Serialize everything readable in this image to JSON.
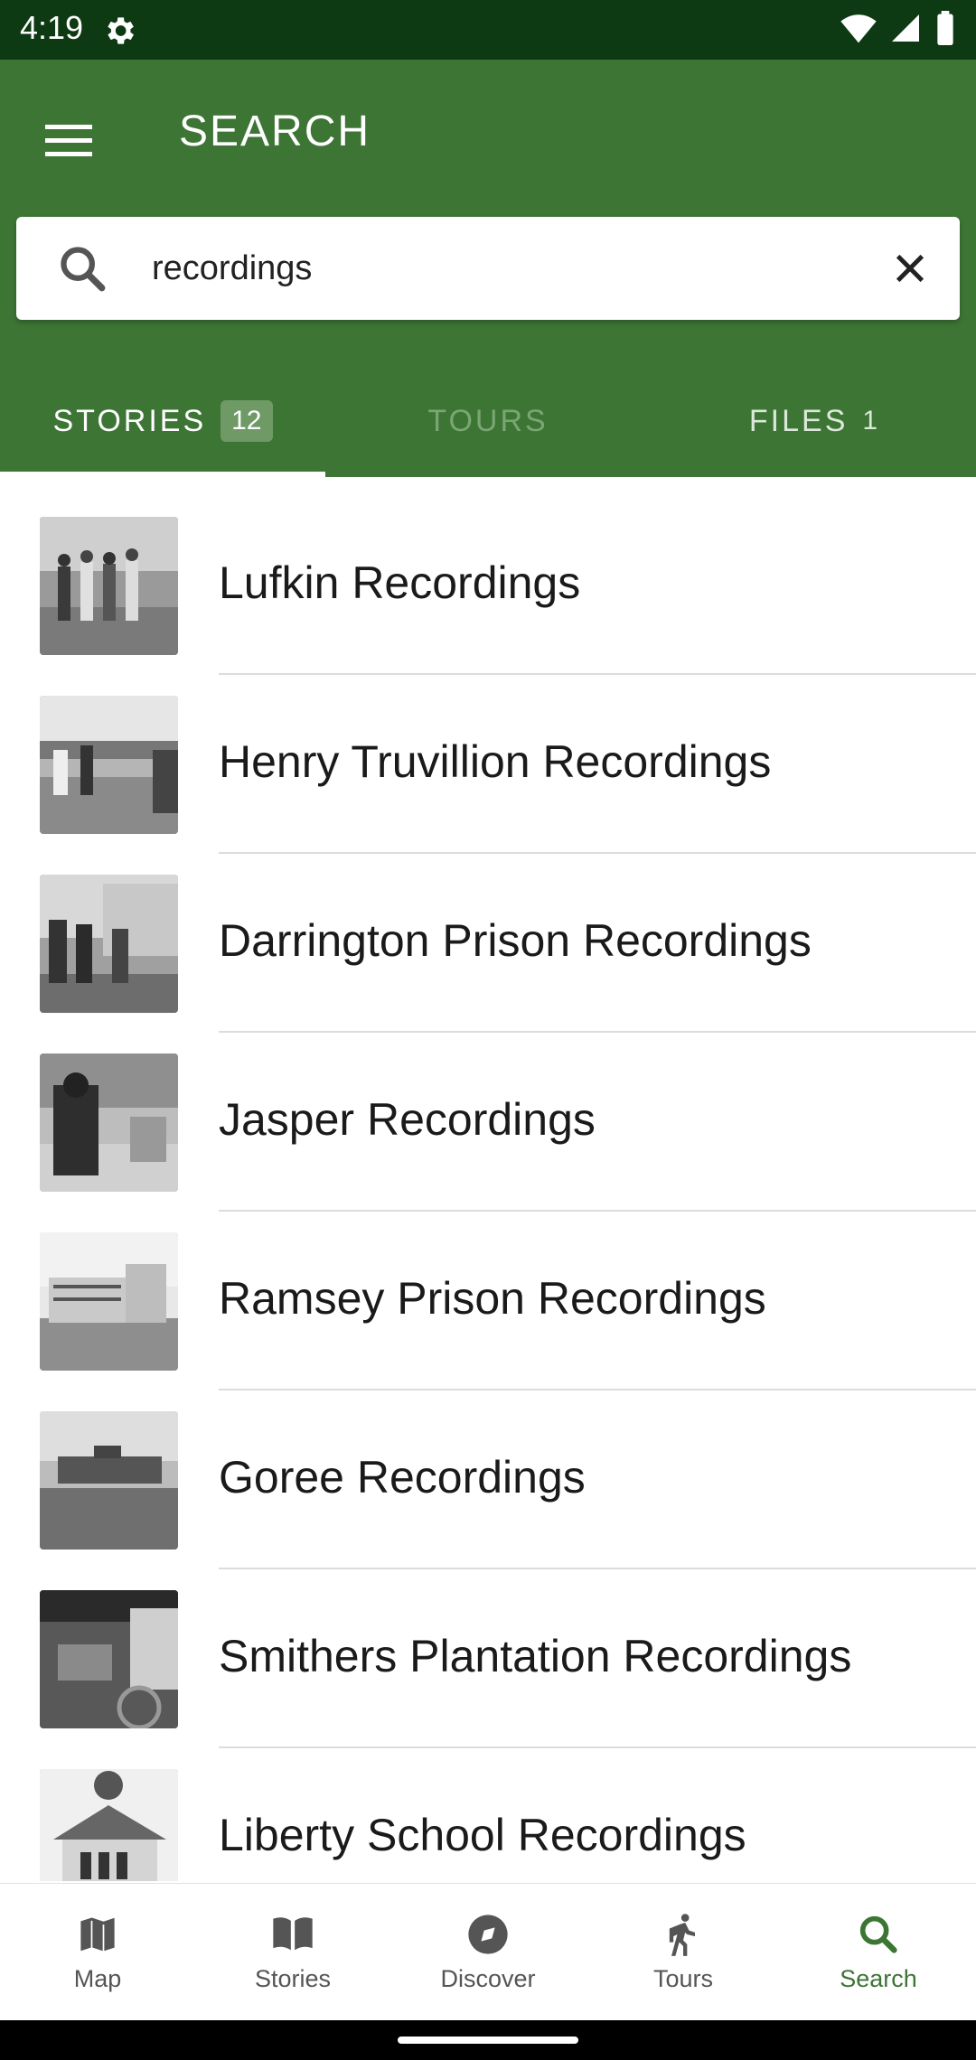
{
  "status_bar": {
    "time": "4:19",
    "icons": [
      "gear-icon",
      "wifi-icon",
      "signal-icon",
      "battery-icon"
    ]
  },
  "app_bar": {
    "title": "SEARCH",
    "menu_icon": "hamburger-menu-icon",
    "color": "#3d7535"
  },
  "search": {
    "value": "recordings",
    "icon": "search-icon",
    "clear_icon": "close-icon"
  },
  "tabs": [
    {
      "label": "STORIES",
      "count": "12",
      "state": "active"
    },
    {
      "label": "TOURS",
      "count": "",
      "state": "disabled"
    },
    {
      "label": "FILES",
      "count": "1",
      "state": "inactive"
    }
  ],
  "results": [
    {
      "title": "Lufkin Recordings"
    },
    {
      "title": "Henry Truvillion Recordings"
    },
    {
      "title": "Darrington Prison Recordings"
    },
    {
      "title": "Jasper Recordings"
    },
    {
      "title": "Ramsey Prison Recordings"
    },
    {
      "title": "Goree Recordings"
    },
    {
      "title": "Smithers Plantation Recordings"
    },
    {
      "title": "Liberty School Recordings"
    }
  ],
  "bottom_nav": [
    {
      "label": "Map",
      "icon": "map-icon"
    },
    {
      "label": "Stories",
      "icon": "book-icon"
    },
    {
      "label": "Discover",
      "icon": "compass-icon"
    },
    {
      "label": "Tours",
      "icon": "walking-icon"
    },
    {
      "label": "Search",
      "icon": "search-icon",
      "active": true
    }
  ]
}
